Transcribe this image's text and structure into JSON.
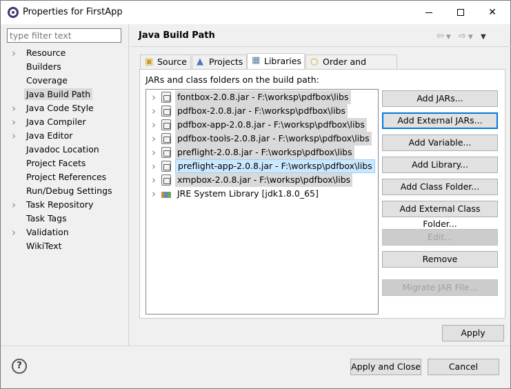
{
  "window": {
    "title": "Properties for FirstApp",
    "minimize_glyph": "",
    "close_glyph": "✕"
  },
  "filter": {
    "placeholder": "type filter text",
    "value": ""
  },
  "nav": {
    "items": [
      {
        "label": "Resource",
        "expandable": true,
        "selected": false
      },
      {
        "label": "Builders",
        "expandable": false,
        "selected": false
      },
      {
        "label": "Coverage",
        "expandable": false,
        "selected": false
      },
      {
        "label": "Java Build Path",
        "expandable": false,
        "selected": true
      },
      {
        "label": "Java Code Style",
        "expandable": true,
        "selected": false
      },
      {
        "label": "Java Compiler",
        "expandable": true,
        "selected": false
      },
      {
        "label": "Java Editor",
        "expandable": true,
        "selected": false
      },
      {
        "label": "Javadoc Location",
        "expandable": false,
        "selected": false
      },
      {
        "label": "Project Facets",
        "expandable": false,
        "selected": false
      },
      {
        "label": "Project References",
        "expandable": false,
        "selected": false
      },
      {
        "label": "Run/Debug Settings",
        "expandable": false,
        "selected": false
      },
      {
        "label": "Task Repository",
        "expandable": true,
        "selected": false
      },
      {
        "label": "Task Tags",
        "expandable": false,
        "selected": false
      },
      {
        "label": "Validation",
        "expandable": true,
        "selected": false
      },
      {
        "label": "WikiText",
        "expandable": false,
        "selected": false
      }
    ]
  },
  "page": {
    "title": "Java Build Path"
  },
  "tabs": [
    {
      "label": "Source",
      "icon": "source-folder-icon",
      "active": false
    },
    {
      "label": "Projects",
      "icon": "projects-icon",
      "active": false
    },
    {
      "label": "Libraries",
      "icon": "libraries-icon",
      "active": true
    },
    {
      "label": "Order and Export",
      "icon": "order-export-icon",
      "active": false
    }
  ],
  "libraries": {
    "heading": "JARs and class folders on the build path:",
    "entries": [
      {
        "text": "fontbox-2.0.8.jar - F:\\worksp\\pdfbox\\libs",
        "icon": "jar-icon",
        "state": "highlight"
      },
      {
        "text": "pdfbox-2.0.8.jar - F:\\worksp\\pdfbox\\libs",
        "icon": "jar-icon",
        "state": "highlight"
      },
      {
        "text": "pdfbox-app-2.0.8.jar - F:\\worksp\\pdfbox\\libs",
        "icon": "jar-icon",
        "state": "highlight"
      },
      {
        "text": "pdfbox-tools-2.0.8.jar - F:\\worksp\\pdfbox\\libs",
        "icon": "jar-icon",
        "state": "highlight"
      },
      {
        "text": "preflight-2.0.8.jar - F:\\worksp\\pdfbox\\libs",
        "icon": "jar-icon",
        "state": "highlight"
      },
      {
        "text": "preflight-app-2.0.8.jar - F:\\worksp\\pdfbox\\libs",
        "icon": "jar-icon",
        "state": "selected"
      },
      {
        "text": "xmpbox-2.0.8.jar - F:\\worksp\\pdfbox\\libs",
        "icon": "jar-icon",
        "state": "highlight"
      },
      {
        "text": "JRE System Library [jdk1.8.0_65]",
        "icon": "library-icon",
        "state": "normal"
      }
    ]
  },
  "buttons": {
    "add_jars": "Add JARs...",
    "add_external_jars": "Add External JARs...",
    "add_variable": "Add Variable...",
    "add_library": "Add Library...",
    "add_class_folder": "Add Class Folder...",
    "add_external_class_folder": "Add External Class Folder...",
    "edit": "Edit...",
    "remove": "Remove",
    "migrate_jar": "Migrate JAR File...",
    "apply": "Apply",
    "apply_and_close": "Apply and Close",
    "cancel": "Cancel"
  },
  "footer": {
    "help_glyph": "?"
  }
}
